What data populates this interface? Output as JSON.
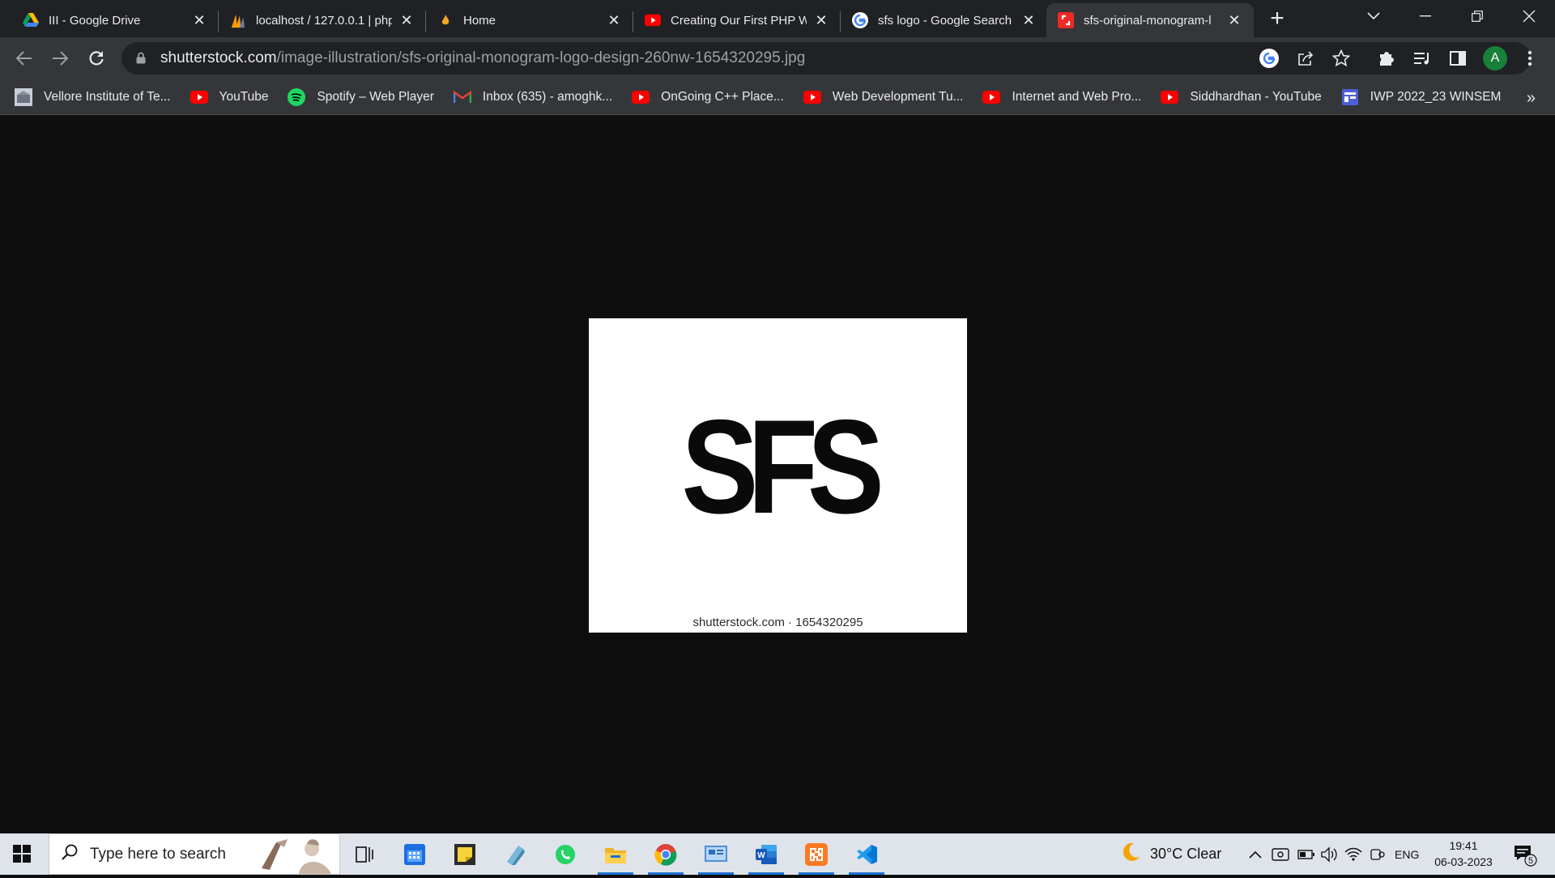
{
  "tabs": [
    {
      "title": "III - Google Drive",
      "icon": "google-drive-icon",
      "active": false
    },
    {
      "title": "localhost / 127.0.0.1 | php",
      "icon": "phpmyadmin-icon",
      "active": false
    },
    {
      "title": "Home",
      "icon": "flame-icon",
      "active": false
    },
    {
      "title": "Creating Our First PHP W",
      "icon": "youtube-icon",
      "active": false
    },
    {
      "title": "sfs logo - Google Search",
      "icon": "google-icon",
      "active": false
    },
    {
      "title": "sfs-original-monogram-l",
      "icon": "shutterstock-icon",
      "active": true
    }
  ],
  "omnibox": {
    "host": "shutterstock.com",
    "path": "/image-illustration/sfs-original-monogram-logo-design-260nw-1654320295.jpg"
  },
  "profile": {
    "initial": "A",
    "color": "#188038"
  },
  "bookmarks": [
    {
      "label": "Vellore Institute of Te...",
      "icon": "vit-icon"
    },
    {
      "label": "YouTube",
      "icon": "youtube-icon"
    },
    {
      "label": "Spotify – Web Player",
      "icon": "spotify-icon"
    },
    {
      "label": "Inbox (635) - amoghk...",
      "icon": "gmail-icon"
    },
    {
      "label": "OnGoing C++ Place...",
      "icon": "youtube-icon"
    },
    {
      "label": "Web Development Tu...",
      "icon": "youtube-icon"
    },
    {
      "label": "Internet and Web Pro...",
      "icon": "youtube-icon"
    },
    {
      "label": "Siddhardhan - YouTube",
      "icon": "youtube-icon"
    },
    {
      "label": "IWP 2022_23 WINSEM",
      "icon": "calendar-grid-icon"
    }
  ],
  "bookmarks_more": "»",
  "image": {
    "logo_text": "SFS",
    "caption": "shutterstock.com · 1654320295"
  },
  "taskbar": {
    "search_placeholder": "Type here to search",
    "weather": "30°C  Clear",
    "language": "ENG",
    "time": "19:41",
    "date": "06-03-2023",
    "notification_count": "5"
  },
  "colors": {
    "accent_red": "#ff0000",
    "tab_bg": "#202124",
    "toolbar_bg": "#35363a",
    "taskbar_bg": "#dfe3ea"
  }
}
